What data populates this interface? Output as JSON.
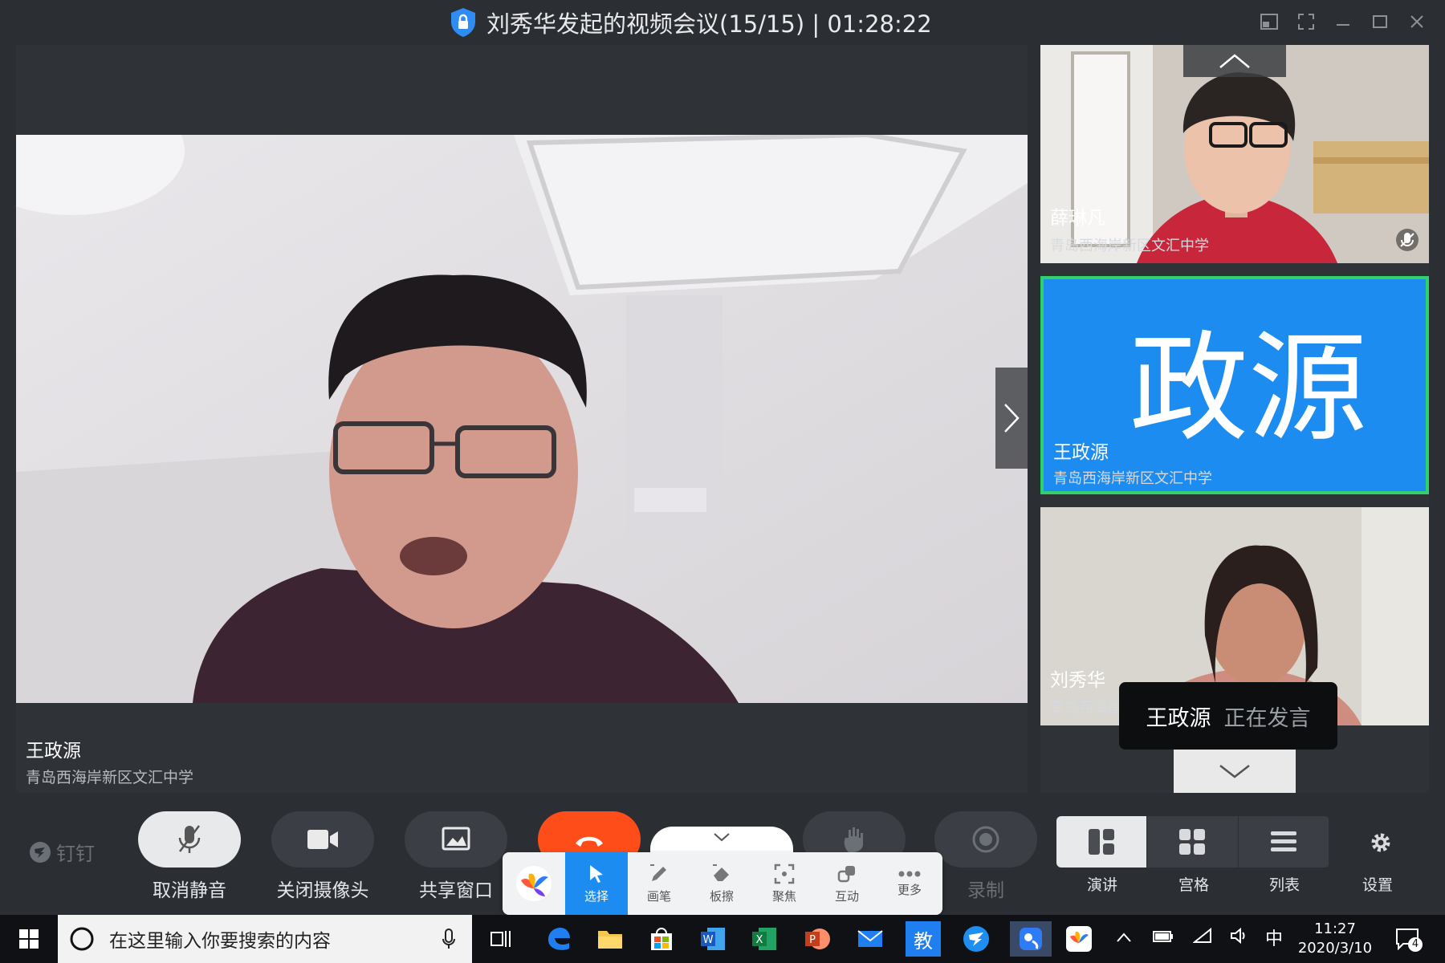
{
  "window": {
    "title": "刘秀华发起的视频会议(15/15) | 01:28:22"
  },
  "main": {
    "speaker_name": "王政源",
    "speaker_org": "青岛西海岸新区文汇中学"
  },
  "tiles": [
    {
      "name": "薛琳凡",
      "org": "青岛西海岸新区文汇中学",
      "muted": true
    },
    {
      "name": "王政源",
      "org": "青岛西海岸新区文汇中学",
      "avatar_text": "政源",
      "active": true
    },
    {
      "name": "刘秀华",
      "org": "青岛西海岸新区文汇中学"
    }
  ],
  "speaking": {
    "name": "王政源",
    "status": "正在发言"
  },
  "brand": "钉钉",
  "controls": {
    "unmute": "取消静音",
    "camera_off": "关闭摄像头",
    "share": "共享窗口",
    "record": "录制"
  },
  "layouts": {
    "speaker": "演讲",
    "grid": "宫格",
    "list": "列表",
    "settings": "设置"
  },
  "annotation_toolbar": {
    "select": "选择",
    "pen": "画笔",
    "eraser": "板擦",
    "focus": "聚焦",
    "interact": "互动",
    "more": "更多"
  },
  "taskbar": {
    "search_placeholder": "在这里输入你要搜索的内容",
    "edu_app": "教",
    "ime": "中",
    "time": "11:27",
    "date": "2020/3/10",
    "notification_count": "4"
  },
  "colors": {
    "accent_blue": "#1d8cf0",
    "active_border": "#2ed16a",
    "hangup_red": "#ff4d1a"
  }
}
